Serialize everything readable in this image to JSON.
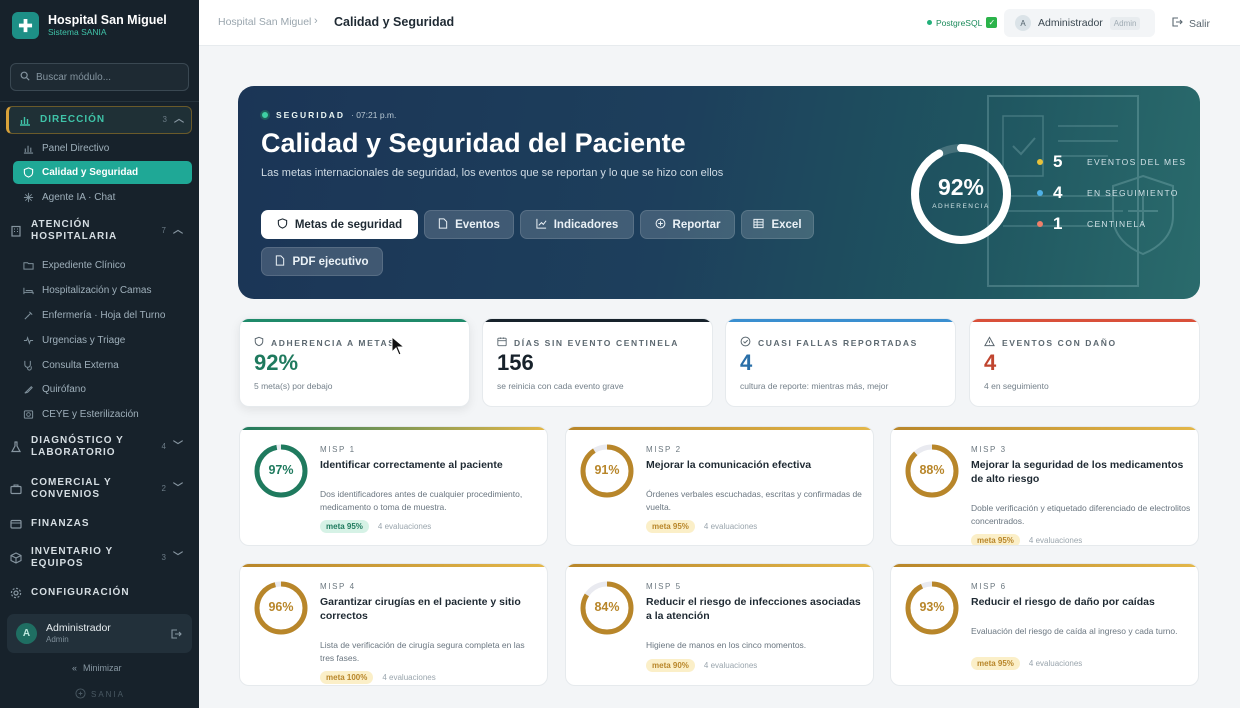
{
  "app": {
    "name": "Hospital San Miguel",
    "subtitle": "Sistema SANIA"
  },
  "search": {
    "placeholder": "Buscar módulo..."
  },
  "sidebar": {
    "sections": [
      {
        "label": "DIRECCIÓN",
        "count": "3",
        "icon": "chart-icon",
        "expanded": true
      },
      {
        "label": "ATENCIÓN HOSPITALARIA",
        "count": "7",
        "icon": "building-icon",
        "expanded": true
      },
      {
        "label": "DIAGNÓSTICO Y LABORATORIO",
        "count": "4",
        "icon": "flask-icon"
      },
      {
        "label": "COMERCIAL Y CONVENIOS",
        "count": "2",
        "icon": "briefcase-icon"
      },
      {
        "label": "FINANZAS",
        "icon": "wallet-icon"
      },
      {
        "label": "INVENTARIO Y EQUIPOS",
        "count": "3",
        "icon": "box-icon"
      },
      {
        "label": "CONFIGURACIÓN",
        "icon": "gear-icon"
      }
    ],
    "direccion_items": [
      "Panel Directivo",
      "Calidad y Seguridad",
      "Agente IA · Chat"
    ],
    "atencion_items": [
      "Expediente Clínico",
      "Hospitalización y Camas",
      "Enfermería · Hoja del Turno",
      "Urgencias y Triage",
      "Consulta Externa",
      "Quirófano",
      "CEYE y Esterilización"
    ],
    "user": {
      "initial": "A",
      "name": "Administrador",
      "role": "Admin"
    },
    "minimize": "Minimizar",
    "footer": "SANIA"
  },
  "topbar": {
    "crumb_root": "Hospital San Miguel",
    "crumb_current": "Calidad y Seguridad",
    "db_status": "PostgreSQL",
    "user_initial": "A",
    "user_name": "Administrador",
    "user_role": "Admin",
    "logout": "Salir"
  },
  "hero": {
    "tag": "SEGURIDAD",
    "time": "· 07:21 p.m.",
    "title": "Calidad y Seguridad del Paciente",
    "description": "Las metas internacionales de seguridad, los eventos que se reportan y lo que se hizo con ellos",
    "buttons": [
      "Metas de seguridad",
      "Eventos",
      "Indicadores",
      "Reportar",
      "Excel",
      "PDF ejecutivo"
    ],
    "adherence": {
      "value": "92%",
      "label": "ADHERENCIA",
      "fraction": 0.92
    },
    "stats": [
      {
        "value": "5",
        "label": "EVENTOS DEL MES",
        "color": "#e8c23a"
      },
      {
        "value": "4",
        "label": "EN SEGUIMIENTO",
        "color": "#4fb0e6"
      },
      {
        "value": "1",
        "label": "CENTINELA",
        "color": "#ef7f6a"
      }
    ]
  },
  "kpis": [
    {
      "title": "ADHERENCIA A METAS",
      "value": "92%",
      "sub": "5 meta(s) por debajo",
      "color": "#1f8a6a"
    },
    {
      "title": "DÍAS SIN EVENTO CENTINELA",
      "value": "156",
      "sub": "se reinicia con cada evento grave",
      "color": "#17222b"
    },
    {
      "title": "CUASI FALLAS REPORTADAS",
      "value": "4",
      "sub": "cultura de reporte: mientras más, mejor",
      "color": "#2a6fa8"
    },
    {
      "title": "EVENTOS CON DAÑO",
      "value": "4",
      "sub": "4 en seguimiento",
      "color": "#c0452f"
    }
  ],
  "goals": [
    {
      "code": "MISP 1",
      "pct": "97%",
      "fraction": 0.97,
      "title": "Identificar correctamente al paciente",
      "desc": "Dos identificadores antes de cualquier procedimiento, medicamento o toma de muestra.",
      "meta": "meta 95%",
      "evals": "4 evaluaciones",
      "status": "ok"
    },
    {
      "code": "MISP 2",
      "pct": "91%",
      "fraction": 0.91,
      "title": "Mejorar la comunicación efectiva",
      "desc": "Órdenes verbales escuchadas, escritas y confirmadas de vuelta.",
      "meta": "meta 95%",
      "evals": "4 evaluaciones",
      "status": "warn"
    },
    {
      "code": "MISP 3",
      "pct": "88%",
      "fraction": 0.88,
      "title": "Mejorar la seguridad de los medicamentos de alto riesgo",
      "desc": "Doble verificación y etiquetado diferenciado de electrolitos concentrados.",
      "meta": "meta 95%",
      "evals": "4 evaluaciones",
      "status": "warn"
    },
    {
      "code": "MISP 4",
      "pct": "96%",
      "fraction": 0.96,
      "title": "Garantizar cirugías en el paciente y sitio correctos",
      "desc": "Lista de verificación de cirugía segura completa en las tres fases.",
      "meta": "meta 100%",
      "evals": "4 evaluaciones",
      "status": "warn"
    },
    {
      "code": "MISP 5",
      "pct": "84%",
      "fraction": 0.84,
      "title": "Reducir el riesgo de infecciones asociadas a la atención",
      "desc": "Higiene de manos en los cinco momentos.",
      "meta": "meta 90%",
      "evals": "4 evaluaciones",
      "status": "warn"
    },
    {
      "code": "MISP 6",
      "pct": "93%",
      "fraction": 0.93,
      "title": "Reducir el riesgo de daño por caídas",
      "desc": "Evaluación del riesgo de caída al ingreso y cada turno.",
      "meta": "meta 95%",
      "evals": "4 evaluaciones",
      "status": "warn"
    }
  ],
  "colors": {
    "ok": "#1f7a5e",
    "warn": "#b8862a",
    "ok_badge_bg": "#d6f2e6",
    "warn_badge_bg": "#fbefc8"
  }
}
